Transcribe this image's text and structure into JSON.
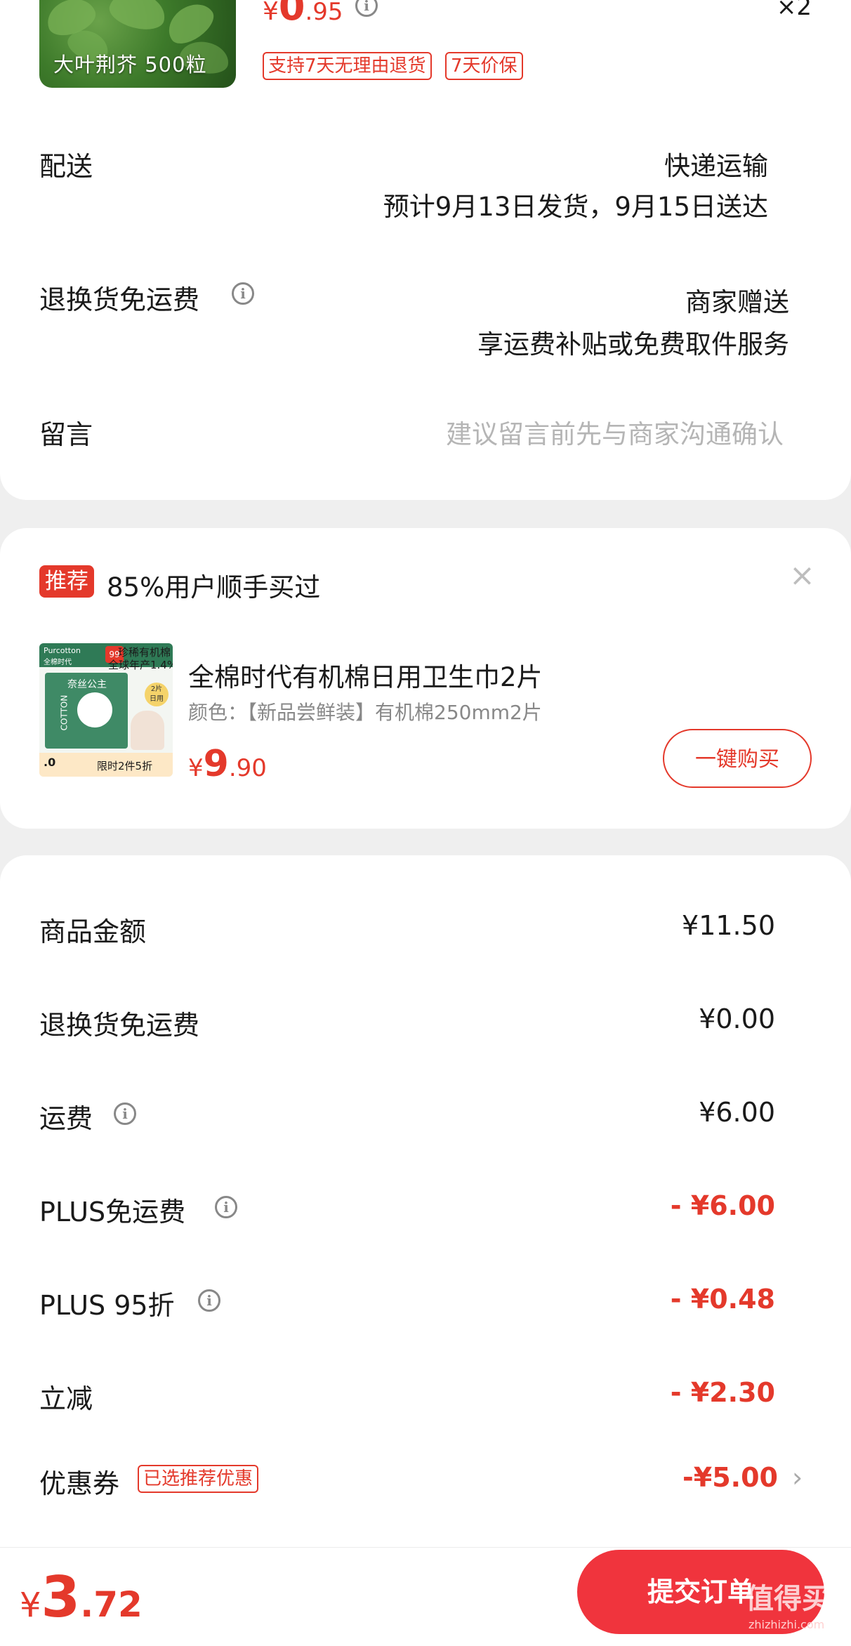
{
  "product": {
    "thumb_caption": "大叶荆芥  500粒",
    "price_symbol": "¥",
    "price_int": "0",
    "price_dec": ".95",
    "quantity": "×2",
    "tags": [
      "支持7天无理由退货",
      "7天价保"
    ]
  },
  "delivery": {
    "label": "配送",
    "method": "快递运输",
    "estimate": "预计9月13日发货，9月15日送达"
  },
  "return_shipping": {
    "label": "退换货免运费",
    "value": "商家赠送",
    "desc": "享运费补贴或免费取件服务"
  },
  "message": {
    "label": "留言",
    "placeholder": "建议留言前先与商家沟通确认"
  },
  "recommend": {
    "badge": "推荐",
    "title": "85%用户顺手买过",
    "close_icon": "close-icon",
    "item": {
      "name": "全棉时代有机棉日用卫生巾2片",
      "spec": "颜色：【新品尝鲜装】有机棉250mm2片",
      "price_symbol": "¥",
      "price_int": "9",
      "price_dec": ".90",
      "image_text_top": "珍稀有机棉",
      "image_text_top2": "全球年产1.4%",
      "image_brand": "Purcotton",
      "image_brand_cn": "全棉时代",
      "image_badge": "99",
      "image_center": "COTTON",
      "image_center2": "奈丝公主",
      "image_corner": "2片",
      "image_corner2": "日用",
      "image_footer": "限时2件5折",
      "image_footer_left": ".0"
    },
    "buy_button": "一键购买"
  },
  "summary": [
    {
      "label": "商品金额",
      "value": "¥11.50",
      "red": false,
      "info": false
    },
    {
      "label": "退换货免运费",
      "value": "¥0.00",
      "red": false,
      "info": false
    },
    {
      "label": "运费",
      "value": "¥6.00",
      "red": false,
      "info": true
    },
    {
      "label": "PLUS免运费",
      "value": "- ¥6.00",
      "red": true,
      "info": true
    },
    {
      "label": "PLUS 95折",
      "value": "- ¥0.48",
      "red": true,
      "info": true
    },
    {
      "label": "立减",
      "value": "- ¥2.30",
      "red": true,
      "info": false
    },
    {
      "label": "优惠券",
      "value": "-¥5.00",
      "red": true,
      "info": false
    }
  ],
  "coupon_tag": "已选推荐优惠",
  "total": {
    "symbol": "¥",
    "int": "3",
    "dec": ".72"
  },
  "submit_button": "提交订单",
  "watermark": {
    "text": "值得买",
    "domain": "zhizhizhi.com"
  },
  "colors": {
    "accent": "#e4392b",
    "submit": "#f0343d"
  }
}
